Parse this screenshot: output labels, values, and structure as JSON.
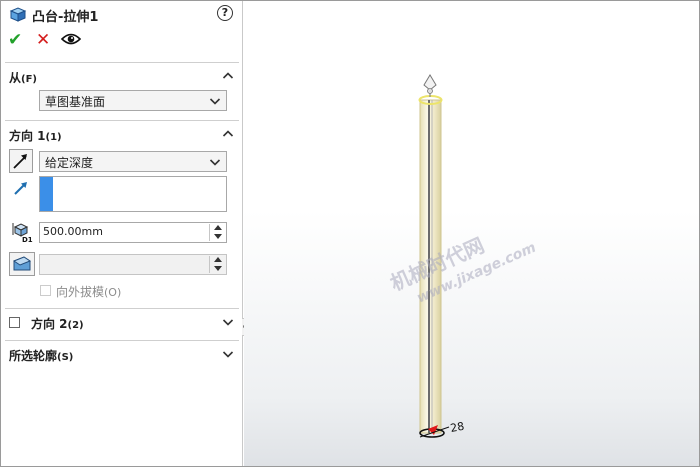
{
  "propertymanager": {
    "title": "凸台-拉伸1",
    "help_glyph": "?",
    "actions": {
      "ok": "✔",
      "cancel": "✕"
    }
  },
  "from_section": {
    "label": "从",
    "hotkey": "(F)",
    "end_condition": "草图基准面"
  },
  "direction1_section": {
    "label": "方向 1",
    "hotkey": "(1)",
    "end_condition": "给定深度",
    "depth_value": "500.00mm",
    "draft_value": "",
    "draft_outward_label": "向外拔模",
    "draft_outward_hotkey": "(O)",
    "depth_icon_tag": "D1"
  },
  "direction2_section": {
    "label": "方向 2",
    "hotkey": "(2)"
  },
  "selected_contours_section": {
    "label": "所选轮廓",
    "hotkey": "(S)"
  },
  "viewport": {
    "dimension_label": "28",
    "watermark": "机械时代网",
    "watermark_url": "www.jixage.com"
  },
  "colors": {
    "accent_blue": "#3b8fe8",
    "ok_green": "#22a12b",
    "cancel_red": "#d41d1d",
    "preview_yellow": "#f0e77a",
    "cylinder_body": "#f5f0d8"
  }
}
